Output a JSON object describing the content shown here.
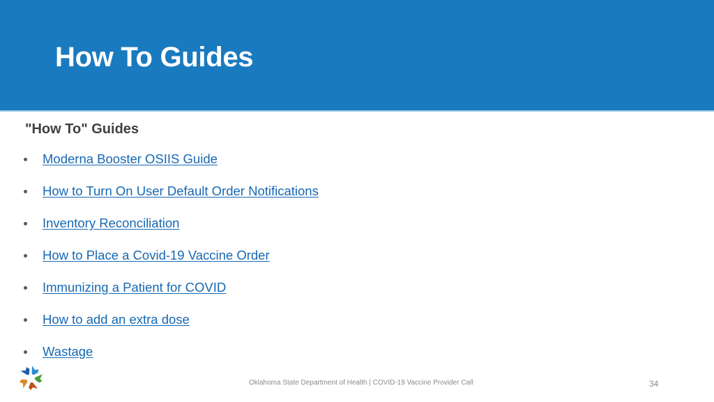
{
  "header": {
    "title": "How To Guides",
    "background_color": "#1a7abf"
  },
  "content": {
    "heading": "\"How To\" Guides",
    "guides": [
      {
        "label": "Moderna Booster OSIIS Guide"
      },
      {
        "label": "How to Turn On User Default Order Notifications"
      },
      {
        "label": "Inventory Reconciliation"
      },
      {
        "label": "How to Place a Covid-19 Vaccine Order"
      },
      {
        "label": "Immunizing a Patient for COVID"
      },
      {
        "label": "How to add an extra dose"
      },
      {
        "label": "Wastage"
      }
    ],
    "link_color": "#1768b3"
  },
  "footer": {
    "logo_icon": "oklahoma-star-logo-icon",
    "text": "Oklahoma State Department of Health | COVID-19 Vaccine Provider Call",
    "page_number": "34"
  }
}
